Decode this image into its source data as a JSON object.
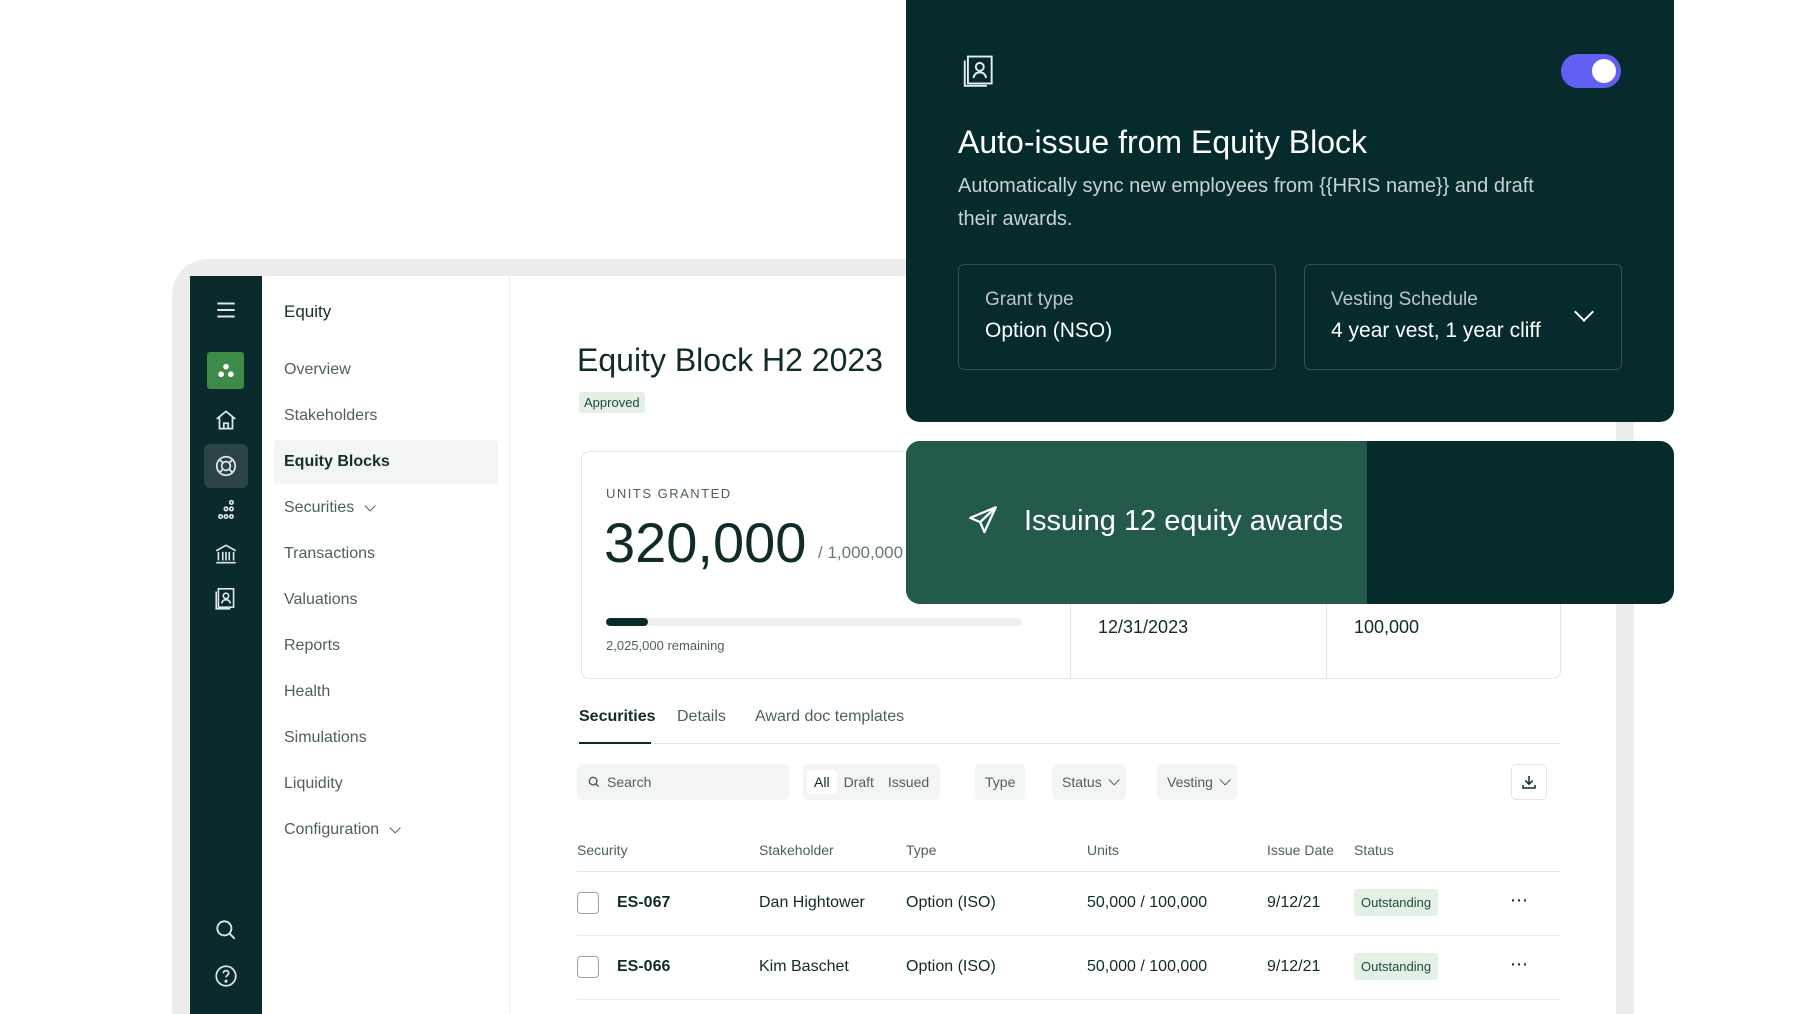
{
  "sidebar": {
    "section_title": "Equity",
    "items": [
      {
        "label": "Overview"
      },
      {
        "label": "Stakeholders"
      },
      {
        "label": "Equity Blocks"
      },
      {
        "label": "Securities"
      },
      {
        "label": "Transactions"
      },
      {
        "label": "Valuations"
      },
      {
        "label": "Reports"
      },
      {
        "label": "Health"
      },
      {
        "label": "Simulations"
      },
      {
        "label": "Liquidity"
      },
      {
        "label": "Configuration"
      }
    ],
    "active_item": "Equity Blocks"
  },
  "rail": {
    "icons": [
      "menu-icon",
      "logo-icon",
      "home-icon",
      "lifebuoy-icon",
      "dots-chart-icon",
      "bank-icon",
      "contact-card-icon",
      "search-icon",
      "help-icon"
    ]
  },
  "page": {
    "title": "Equity Block H2 2023",
    "status_badge": "Approved"
  },
  "stats": {
    "units_label": "UNITS GRANTED",
    "units_value": "320,000",
    "units_total": "/ 1,000,000",
    "progress_fraction": 0.1,
    "remaining": "2,025,000 remaining",
    "date": "12/31/2023",
    "amount": "100,000"
  },
  "tabs": [
    {
      "label": "Securities",
      "active": true
    },
    {
      "label": "Details",
      "active": false
    },
    {
      "label": "Award doc templates",
      "active": false
    }
  ],
  "toolbar": {
    "search_placeholder": "Search",
    "segments": [
      "All",
      "Draft",
      "Issued"
    ],
    "active_segment": "All",
    "type_filter": "Type",
    "status_filter": "Status",
    "vesting_filter": "Vesting"
  },
  "table": {
    "headers": [
      "Security",
      "Stakeholder",
      "Type",
      "Units",
      "Issue Date",
      "Status"
    ],
    "rows": [
      {
        "security": "ES-067",
        "stakeholder": "Dan Hightower",
        "type": "Option (ISO)",
        "units": "50,000 / 100,000",
        "issue_date": "9/12/21",
        "status": "Outstanding"
      },
      {
        "security": "ES-066",
        "stakeholder": "Kim Baschet",
        "type": "Option (ISO)",
        "units": "50,000 / 100,000",
        "issue_date": "9/12/21",
        "status": "Outstanding"
      }
    ]
  },
  "card": {
    "toggle_on": true,
    "title": "Auto-issue from Equity Block",
    "subtitle": "Automatically sync new employees from {{HRIS name}} and draft their awards.",
    "grant_type_label": "Grant type",
    "grant_type_value": "Option (NSO)",
    "vesting_label": "Vesting Schedule",
    "vesting_value": "4 year vest, 1 year cliff"
  },
  "banner": {
    "text": "Issuing 12  equity awards",
    "progress_fraction": 0.6
  },
  "colors": {
    "dark_teal": "#062b2c",
    "banner_fill": "#235a4b",
    "toggle": "#6260f2",
    "badge_bg": "#e3f0e6",
    "brand_green": "#3d8b46"
  }
}
